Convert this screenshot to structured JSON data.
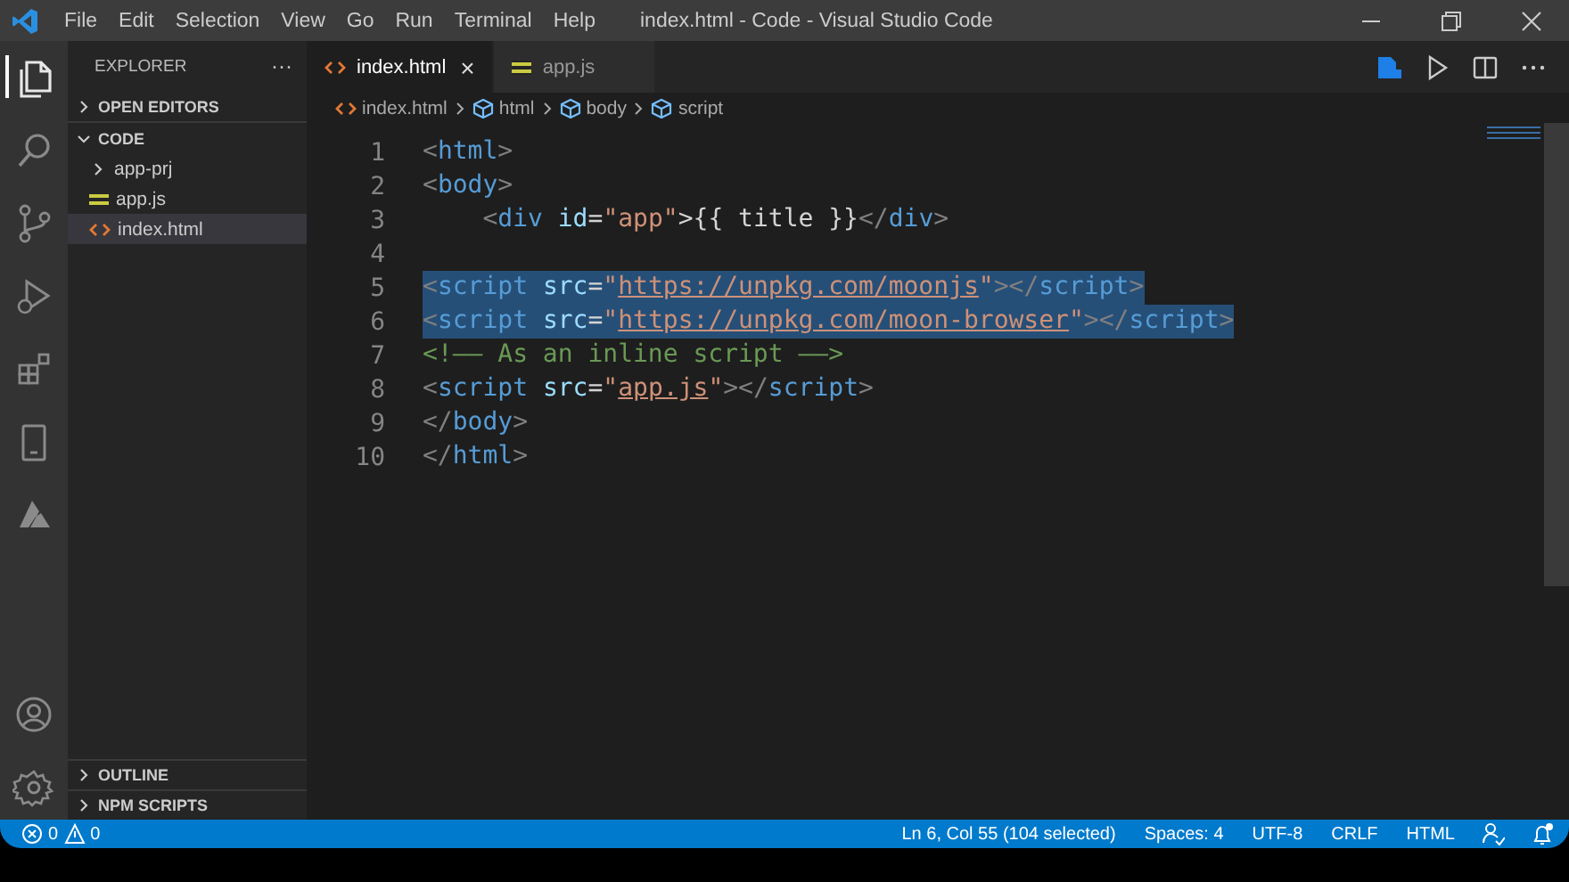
{
  "window": {
    "title": "index.html - Code - Visual Studio Code"
  },
  "menu": [
    "File",
    "Edit",
    "Selection",
    "View",
    "Go",
    "Run",
    "Terminal",
    "Help"
  ],
  "activity_bar": [
    {
      "kind": "files",
      "selected": true
    },
    {
      "kind": "search",
      "selected": false
    },
    {
      "kind": "branch",
      "selected": false
    },
    {
      "kind": "run",
      "selected": false
    },
    {
      "kind": "extensions",
      "selected": false
    },
    {
      "kind": "device",
      "selected": false
    },
    {
      "kind": "azure",
      "selected": false
    }
  ],
  "sidebar": {
    "title": "EXPLORER",
    "more": "···",
    "sections": [
      {
        "label": "OPEN EDITORS",
        "expanded": false
      },
      {
        "label": "CODE",
        "expanded": true,
        "items": [
          {
            "label": "app-prj",
            "kind": "folder",
            "selected": false
          },
          {
            "label": "app.js",
            "kind": "js",
            "selected": false
          },
          {
            "label": "index.html",
            "kind": "html",
            "selected": true
          }
        ]
      }
    ],
    "bottom_sections": [
      {
        "label": "OUTLINE",
        "expanded": false
      },
      {
        "label": "NPM SCRIPTS",
        "expanded": false
      }
    ]
  },
  "tabs": [
    {
      "label": "index.html",
      "kind": "html",
      "selected": true,
      "close": "×"
    },
    {
      "label": "app.js",
      "kind": "js",
      "selected": false
    }
  ],
  "breadcrumb": [
    {
      "label": "index.html",
      "kind": "html"
    },
    {
      "label": "html",
      "kind": "element"
    },
    {
      "label": "body",
      "kind": "element"
    },
    {
      "label": "script",
      "kind": "element"
    }
  ],
  "editor": {
    "lines": [
      {
        "number": "1",
        "selected": false,
        "tokens": [
          {
            "text": "<",
            "kind": "punct"
          },
          {
            "text": "html",
            "kind": "tag"
          },
          {
            "text": ">",
            "kind": "punct"
          }
        ]
      },
      {
        "number": "2",
        "selected": false,
        "tokens": [
          {
            "text": "<",
            "kind": "punct"
          },
          {
            "text": "body",
            "kind": "tag"
          },
          {
            "text": ">",
            "kind": "punct"
          }
        ]
      },
      {
        "number": "3",
        "selected": false,
        "tokens": [
          {
            "text": "    <",
            "kind": "punct"
          },
          {
            "text": "div",
            "kind": "tag"
          },
          {
            "text": " id",
            "kind": "attr"
          },
          {
            "text": "=",
            "kind": "plain"
          },
          {
            "text": "\"app\"",
            "kind": "string"
          },
          {
            "text": ">{{ title }}",
            "kind": "plain"
          },
          {
            "text": "</",
            "kind": "punct"
          },
          {
            "text": "div",
            "kind": "tag"
          },
          {
            "text": ">",
            "kind": "punct"
          }
        ]
      },
      {
        "number": "4"
      },
      {
        "number": "5",
        "selected": true,
        "tokens": [
          {
            "text": "<",
            "kind": "punct"
          },
          {
            "text": "script",
            "kind": "tag"
          },
          {
            "text": " src",
            "kind": "attr"
          },
          {
            "text": "=",
            "kind": "plain"
          },
          {
            "text": "\"",
            "kind": "string"
          },
          {
            "text": "https://unpkg.com/moonjs",
            "kind": "link"
          },
          {
            "text": "\"",
            "kind": "string"
          },
          {
            "text": "></",
            "kind": "punct"
          },
          {
            "text": "script",
            "kind": "tag"
          },
          {
            "text": ">",
            "kind": "punct"
          }
        ]
      },
      {
        "number": "6",
        "selected": true,
        "tokens": [
          {
            "text": "<",
            "kind": "punct"
          },
          {
            "text": "script",
            "kind": "tag"
          },
          {
            "text": " src",
            "kind": "attr"
          },
          {
            "text": "=",
            "kind": "plain"
          },
          {
            "text": "\"",
            "kind": "string"
          },
          {
            "text": "https://unpkg.com/moon-browser",
            "kind": "link"
          },
          {
            "text": "\"",
            "kind": "string"
          },
          {
            "text": "></",
            "kind": "punct"
          },
          {
            "text": "script",
            "kind": "tag"
          },
          {
            "text": ">",
            "kind": "punct"
          }
        ]
      },
      {
        "number": "7",
        "selected": false,
        "tokens": [
          {
            "text": "<!—— As an inline script ——>",
            "kind": "comment"
          }
        ]
      },
      {
        "number": "8",
        "selected": false,
        "tokens": [
          {
            "text": "<",
            "kind": "punct"
          },
          {
            "text": "script",
            "kind": "tag"
          },
          {
            "text": " src",
            "kind": "attr"
          },
          {
            "text": "=",
            "kind": "plain"
          },
          {
            "text": "\"",
            "kind": "string"
          },
          {
            "text": "app.js",
            "kind": "link"
          },
          {
            "text": "\"",
            "kind": "string"
          },
          {
            "text": "></",
            "kind": "punct"
          },
          {
            "text": "script",
            "kind": "tag"
          },
          {
            "text": ">",
            "kind": "punct"
          }
        ]
      },
      {
        "number": "9",
        "selected": false,
        "tokens": [
          {
            "text": "</",
            "kind": "punct"
          },
          {
            "text": "body",
            "kind": "tag"
          },
          {
            "text": ">",
            "kind": "punct"
          }
        ]
      },
      {
        "number": "10",
        "selected": false,
        "tokens": [
          {
            "text": "</",
            "kind": "punct"
          },
          {
            "text": "html",
            "kind": "tag"
          },
          {
            "text": ">",
            "kind": "punct"
          }
        ]
      }
    ]
  },
  "status_bar": {
    "errors": "0",
    "warnings": "0",
    "items": [
      "Ln 6, Col 55 (104 selected)",
      "Spaces: 4",
      "UTF-8",
      "CRLF",
      "HTML"
    ]
  }
}
